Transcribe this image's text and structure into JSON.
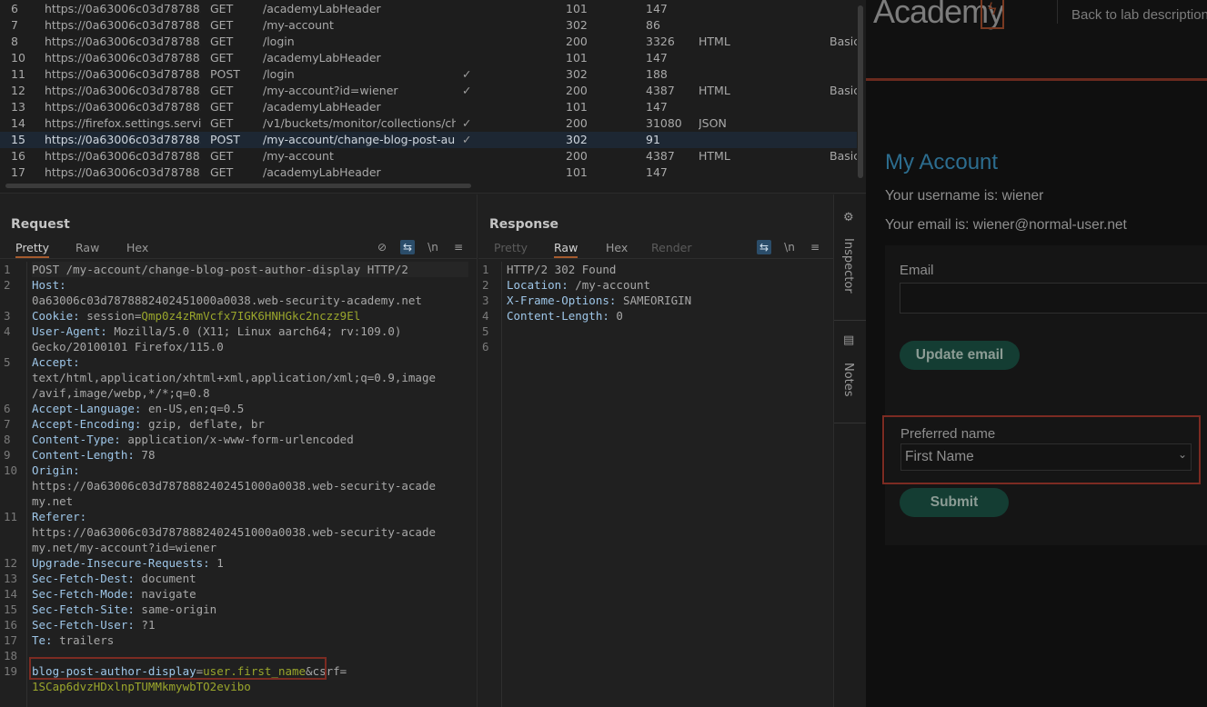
{
  "history": {
    "rows": [
      {
        "id": "6",
        "host": "https://0a63006c03d78788...",
        "method": "GET",
        "url": "/academyLabHeader",
        "edited": false,
        "status": "101",
        "length": "147",
        "mime": "",
        "title": ""
      },
      {
        "id": "7",
        "host": "https://0a63006c03d78788...",
        "method": "GET",
        "url": "/my-account",
        "edited": false,
        "status": "302",
        "length": "86",
        "mime": "",
        "title": ""
      },
      {
        "id": "8",
        "host": "https://0a63006c03d78788...",
        "method": "GET",
        "url": "/login",
        "edited": false,
        "status": "200",
        "length": "3326",
        "mime": "HTML",
        "title": "Basic"
      },
      {
        "id": "10",
        "host": "https://0a63006c03d78788...",
        "method": "GET",
        "url": "/academyLabHeader",
        "edited": false,
        "status": "101",
        "length": "147",
        "mime": "",
        "title": ""
      },
      {
        "id": "11",
        "host": "https://0a63006c03d78788...",
        "method": "POST",
        "url": "/login",
        "edited": true,
        "status": "302",
        "length": "188",
        "mime": "",
        "title": ""
      },
      {
        "id": "12",
        "host": "https://0a63006c03d78788...",
        "method": "GET",
        "url": "/my-account?id=wiener",
        "edited": true,
        "status": "200",
        "length": "4387",
        "mime": "HTML",
        "title": "Basic"
      },
      {
        "id": "13",
        "host": "https://0a63006c03d78788...",
        "method": "GET",
        "url": "/academyLabHeader",
        "edited": false,
        "status": "101",
        "length": "147",
        "mime": "",
        "title": ""
      },
      {
        "id": "14",
        "host": "https://firefox.settings.servic...",
        "method": "GET",
        "url": "/v1/buckets/monitor/collections/ch...",
        "edited": true,
        "status": "200",
        "length": "31080",
        "mime": "JSON",
        "title": ""
      },
      {
        "id": "15",
        "host": "https://0a63006c03d78788...",
        "method": "POST",
        "url": "/my-account/change-blog-post-au...",
        "edited": true,
        "status": "302",
        "length": "91",
        "mime": "",
        "title": "",
        "selected": true
      },
      {
        "id": "16",
        "host": "https://0a63006c03d78788...",
        "method": "GET",
        "url": "/my-account",
        "edited": false,
        "status": "200",
        "length": "4387",
        "mime": "HTML",
        "title": "Basic"
      },
      {
        "id": "17",
        "host": "https://0a63006c03d78788...",
        "method": "GET",
        "url": "/academyLabHeader",
        "edited": false,
        "status": "101",
        "length": "147",
        "mime": "",
        "title": ""
      }
    ],
    "check_glyph": "✓"
  },
  "request": {
    "title": "Request",
    "tabs": [
      "Pretty",
      "Raw",
      "Hex"
    ],
    "active_tab": "Pretty",
    "tools": {
      "hide": "⊘",
      "wrap": "⇆",
      "newline": "\\n",
      "menu": "≡"
    },
    "lines": [
      {
        "n": "1",
        "parts": [
          {
            "t": "POST /my-account/change-blog-post-author-display HTTP/2",
            "c": "hv"
          }
        ]
      },
      {
        "n": "2",
        "parts": [
          {
            "t": "Host:",
            "c": "hk"
          }
        ]
      },
      {
        "n": "",
        "parts": [
          {
            "t": "0a63006c03d7878882402451000a0038.web-security-academy.net",
            "c": "hv"
          }
        ]
      },
      {
        "n": "3",
        "parts": [
          {
            "t": "Cookie:",
            "c": "hk"
          },
          {
            "t": " session=",
            "c": "hv"
          },
          {
            "t": "Qmp0z4zRmVcfx7IGK6HNHGkc2nczz9El",
            "c": "hl"
          }
        ]
      },
      {
        "n": "4",
        "parts": [
          {
            "t": "User-Agent:",
            "c": "hk"
          },
          {
            "t": " Mozilla/5.0 (X11; Linux aarch64; rv:109.0)",
            "c": "hv"
          }
        ]
      },
      {
        "n": "",
        "parts": [
          {
            "t": "Gecko/20100101 Firefox/115.0",
            "c": "hv"
          }
        ]
      },
      {
        "n": "5",
        "parts": [
          {
            "t": "Accept:",
            "c": "hk"
          }
        ]
      },
      {
        "n": "",
        "parts": [
          {
            "t": "text/html,application/xhtml+xml,application/xml;q=0.9,image",
            "c": "hv"
          }
        ]
      },
      {
        "n": "",
        "parts": [
          {
            "t": "/avif,image/webp,*/*;q=0.8",
            "c": "hv"
          }
        ]
      },
      {
        "n": "6",
        "parts": [
          {
            "t": "Accept-Language:",
            "c": "hk"
          },
          {
            "t": " en-US,en;q=0.5",
            "c": "hv"
          }
        ]
      },
      {
        "n": "7",
        "parts": [
          {
            "t": "Accept-Encoding:",
            "c": "hk"
          },
          {
            "t": " gzip, deflate, br",
            "c": "hv"
          }
        ]
      },
      {
        "n": "8",
        "parts": [
          {
            "t": "Content-Type:",
            "c": "hk"
          },
          {
            "t": " application/x-www-form-urlencoded",
            "c": "hv"
          }
        ]
      },
      {
        "n": "9",
        "parts": [
          {
            "t": "Content-Length:",
            "c": "hk"
          },
          {
            "t": " 78",
            "c": "hv"
          }
        ]
      },
      {
        "n": "10",
        "parts": [
          {
            "t": "Origin:",
            "c": "hk"
          }
        ]
      },
      {
        "n": "",
        "parts": [
          {
            "t": "https://0a63006c03d7878882402451000a0038.web-security-acade",
            "c": "hv"
          }
        ]
      },
      {
        "n": "",
        "parts": [
          {
            "t": "my.net",
            "c": "hv"
          }
        ]
      },
      {
        "n": "11",
        "parts": [
          {
            "t": "Referer:",
            "c": "hk"
          }
        ]
      },
      {
        "n": "",
        "parts": [
          {
            "t": "https://0a63006c03d7878882402451000a0038.web-security-acade",
            "c": "hv"
          }
        ]
      },
      {
        "n": "",
        "parts": [
          {
            "t": "my.net/my-account?id=wiener",
            "c": "hv"
          }
        ]
      },
      {
        "n": "12",
        "parts": [
          {
            "t": "Upgrade-Insecure-Requests:",
            "c": "hk"
          },
          {
            "t": " 1",
            "c": "hv"
          }
        ]
      },
      {
        "n": "13",
        "parts": [
          {
            "t": "Sec-Fetch-Dest:",
            "c": "hk"
          },
          {
            "t": " document",
            "c": "hv"
          }
        ]
      },
      {
        "n": "14",
        "parts": [
          {
            "t": "Sec-Fetch-Mode:",
            "c": "hk"
          },
          {
            "t": " navigate",
            "c": "hv"
          }
        ]
      },
      {
        "n": "15",
        "parts": [
          {
            "t": "Sec-Fetch-Site:",
            "c": "hk"
          },
          {
            "t": " same-origin",
            "c": "hv"
          }
        ]
      },
      {
        "n": "16",
        "parts": [
          {
            "t": "Sec-Fetch-User:",
            "c": "hk"
          },
          {
            "t": " ?1",
            "c": "hv"
          }
        ]
      },
      {
        "n": "17",
        "parts": [
          {
            "t": "Te:",
            "c": "hk"
          },
          {
            "t": " trailers",
            "c": "hv"
          }
        ]
      },
      {
        "n": "18",
        "parts": [
          {
            "t": "",
            "c": "hv"
          }
        ]
      },
      {
        "n": "19",
        "parts": [
          {
            "t": "blog-post-author-display",
            "c": "hk"
          },
          {
            "t": "=",
            "c": "hv"
          },
          {
            "t": "user.first_name",
            "c": "hl"
          },
          {
            "t": "&csrf=",
            "c": "hv"
          }
        ]
      },
      {
        "n": "",
        "parts": [
          {
            "t": "1SCap6dvzHDxlnpTUMMkmywbTO2evibo",
            "c": "hl"
          }
        ]
      }
    ]
  },
  "response": {
    "title": "Response",
    "tabs": [
      "Pretty",
      "Raw",
      "Hex",
      "Render"
    ],
    "active_tab": "Raw",
    "lines": [
      {
        "n": "1",
        "parts": [
          {
            "t": "HTTP/2 302 Found",
            "c": "hv"
          }
        ]
      },
      {
        "n": "2",
        "parts": [
          {
            "t": "Location:",
            "c": "hk"
          },
          {
            "t": " /my-account",
            "c": "hv"
          }
        ]
      },
      {
        "n": "3",
        "parts": [
          {
            "t": "X-Frame-Options:",
            "c": "hk"
          },
          {
            "t": " SAMEORIGIN",
            "c": "hv"
          }
        ]
      },
      {
        "n": "4",
        "parts": [
          {
            "t": "Content-Length:",
            "c": "hk"
          },
          {
            "t": " 0",
            "c": "hv"
          }
        ]
      },
      {
        "n": "5",
        "parts": [
          {
            "t": "",
            "c": "hv"
          }
        ]
      },
      {
        "n": "6",
        "parts": [
          {
            "t": "",
            "c": "hv"
          }
        ]
      }
    ]
  },
  "inspector": {
    "inspector_label": "Inspector",
    "notes_label": "Notes"
  },
  "browser": {
    "logo_text": "Academy",
    "back_link": "Back to lab description",
    "page_title": "My Account",
    "username_line": "Your username is: wiener",
    "email_line": "Your email is: wiener@normal-user.net",
    "email_label": "Email",
    "email_value": "",
    "update_email_button": "Update email",
    "preferred_name_label": "Preferred name",
    "preferred_name_selected": "First Name",
    "submit_button": "Submit"
  },
  "colors": {
    "accent_orange": "#a45a2e",
    "highlight_red": "#7c2b22",
    "link_blue": "#2c6d8f",
    "button_green": "#143d33"
  }
}
